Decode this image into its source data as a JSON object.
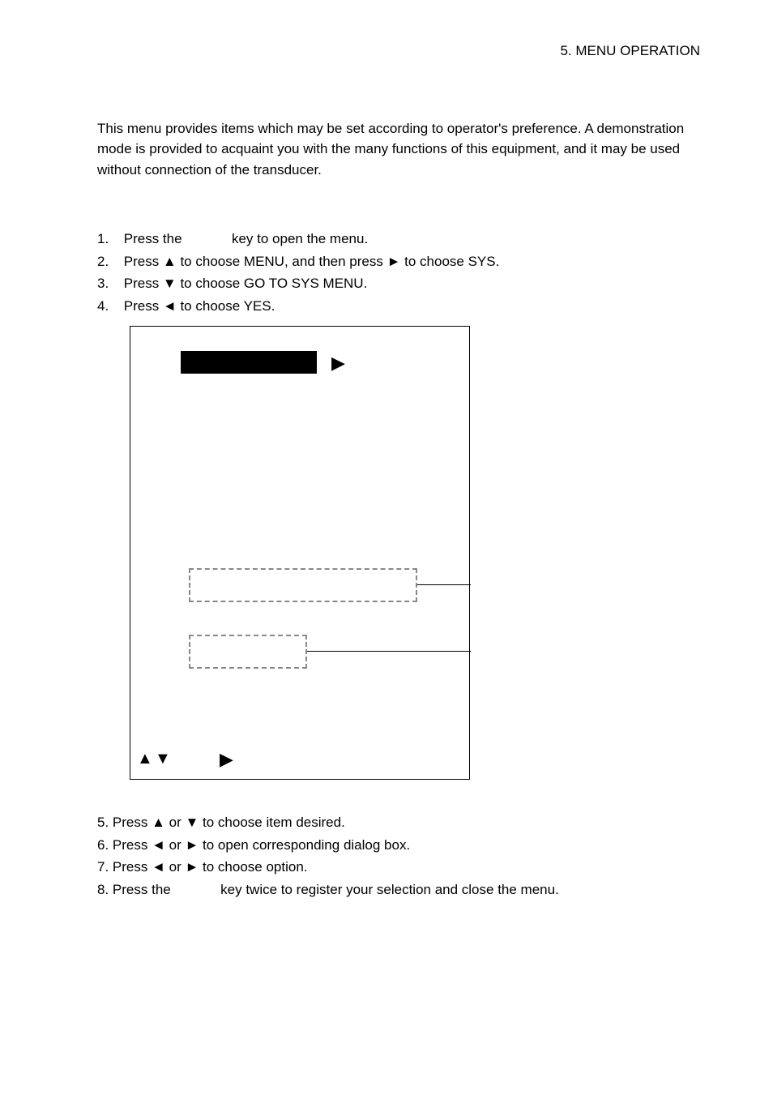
{
  "header": "5.  MENU  OPERATION",
  "intro": "This menu provides items which may be set according to operator's preference. A demonstration mode is provided to acquaint you with the many functions of this equipment, and it may be used without connection of the transducer.",
  "steps1": {
    "s1_num": "1.",
    "s1_a": "Press the",
    "s1_b": "key to open the menu.",
    "s2_num": "2.",
    "s2": "Press ▲ to choose MENU, and then press ► to choose SYS.",
    "s3_num": "3.",
    "s3": "Press ▼ to choose GO TO SYS MENU.",
    "s4_num": "4.",
    "s4": "Press ◄ to choose YES."
  },
  "diagram": {
    "play_top": "▶",
    "tri_up": "▲",
    "tri_down": "▼",
    "play_bot": "▶"
  },
  "steps2": {
    "s5_num": "5.",
    "s5": "Press ▲ or ▼ to choose item desired.",
    "s6_num": "6.",
    "s6": "Press ◄ or ► to open corresponding dialog box.",
    "s7_num": "7.",
    "s7": "Press ◄ or ► to choose option.",
    "s8_num": "8.",
    "s8_a": "Press the",
    "s8_b": "key twice to register your selection and close the menu."
  }
}
